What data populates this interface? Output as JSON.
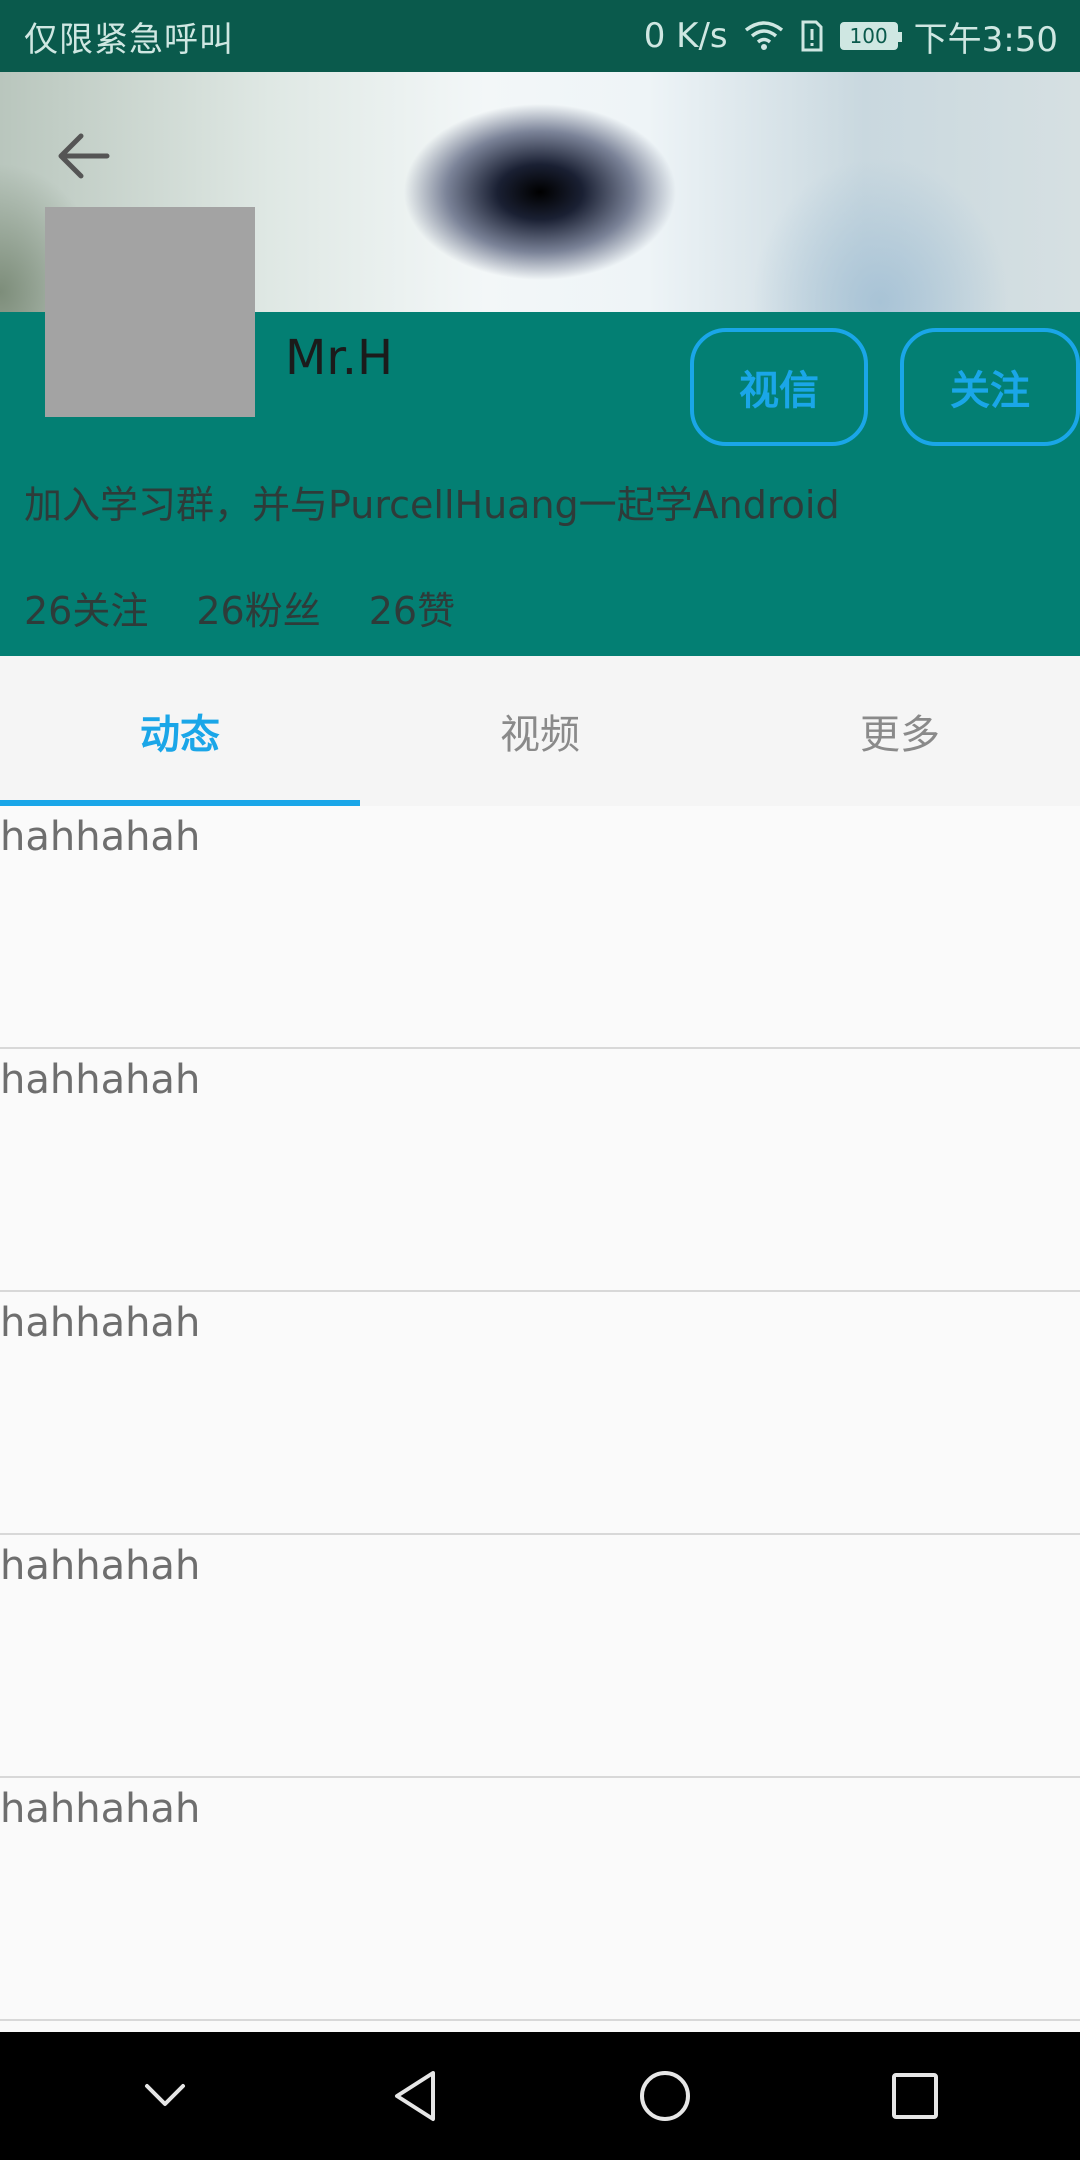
{
  "status_bar": {
    "carrier": "仅限紧急呼叫",
    "net_speed": "0 K/s",
    "battery": "100",
    "time": "下午3:50"
  },
  "profile": {
    "username": "Mr.H",
    "bio": "加入学习群，并与PurcellHuang一起学Android",
    "message_button": "视信",
    "follow_button": "关注",
    "stats": {
      "following": "26关注",
      "fans": "26粉丝",
      "likes": "26赞"
    }
  },
  "tabs": [
    {
      "label": "动态",
      "active": true
    },
    {
      "label": "视频",
      "active": false
    },
    {
      "label": "更多",
      "active": false
    }
  ],
  "list": {
    "items": [
      "hahhahah",
      "hahhahah",
      "hahhahah",
      "hahhahah",
      "hahhahah"
    ]
  },
  "colors": {
    "accent": "#1aa6e8",
    "teal": "#037f73",
    "status_bar": "#0a5a4c"
  },
  "icons": {
    "back": "arrow-left-icon",
    "wifi": "wifi-icon",
    "sim_alert": "sim-alert-icon",
    "battery": "battery-icon",
    "nav_down": "chevron-down-icon",
    "nav_back": "triangle-back-icon",
    "nav_home": "circle-home-icon",
    "nav_recent": "square-recent-icon"
  }
}
